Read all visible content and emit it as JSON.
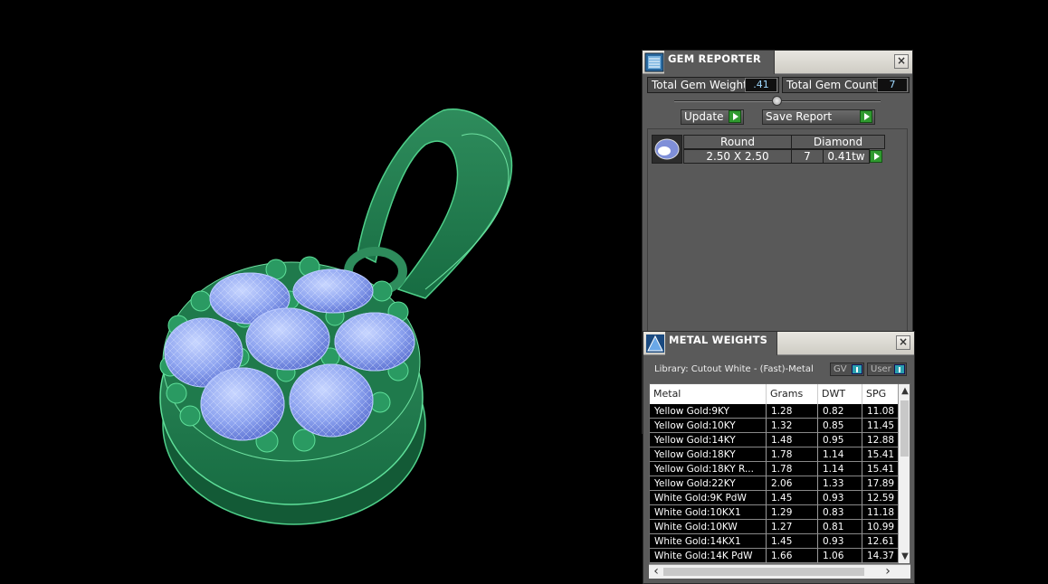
{
  "gem_reporter": {
    "title": "GEM REPORTER",
    "close_label": "×",
    "total_weight_label": "Total Gem Weight",
    "total_weight_value": ".41",
    "total_count_label": "Total Gem Count",
    "total_count_value": "7",
    "update_label": "Update",
    "save_report_label": "Save Report",
    "gems": [
      {
        "shape": "Round",
        "size": "2.50 X 2.50",
        "material": "Diamond",
        "count": "7",
        "weight": "0.41tw"
      }
    ]
  },
  "metal_weights": {
    "title": "METAL WEIGHTS",
    "close_label": "×",
    "library_text": "Library: Cutout White - (Fast)-Metal",
    "toggle_gv": "GV",
    "toggle_user": "User",
    "columns": [
      "Metal",
      "Grams",
      "DWT",
      "SPG"
    ],
    "rows": [
      [
        "Yellow Gold:9KY",
        "1.28",
        "0.82",
        "11.08"
      ],
      [
        "Yellow Gold:10KY",
        "1.32",
        "0.85",
        "11.45"
      ],
      [
        "Yellow Gold:14KY",
        "1.48",
        "0.95",
        "12.88"
      ],
      [
        "Yellow Gold:18KY",
        "1.78",
        "1.14",
        "15.41"
      ],
      [
        "Yellow Gold:18KY R...",
        "1.78",
        "1.14",
        "15.41"
      ],
      [
        "Yellow Gold:22KY",
        "2.06",
        "1.33",
        "17.89"
      ],
      [
        "White Gold:9K PdW",
        "1.45",
        "0.93",
        "12.59"
      ],
      [
        "White Gold:10KX1",
        "1.29",
        "0.83",
        "11.18"
      ],
      [
        "White Gold:10KW",
        "1.27",
        "0.81",
        "10.99"
      ],
      [
        "White Gold:14KX1",
        "1.45",
        "0.93",
        "12.61"
      ],
      [
        "White Gold:14K PdW",
        "1.66",
        "1.06",
        "14.37"
      ]
    ]
  },
  "scroll": {
    "up": "▲",
    "down": "▼",
    "left": "‹",
    "right": "›"
  }
}
